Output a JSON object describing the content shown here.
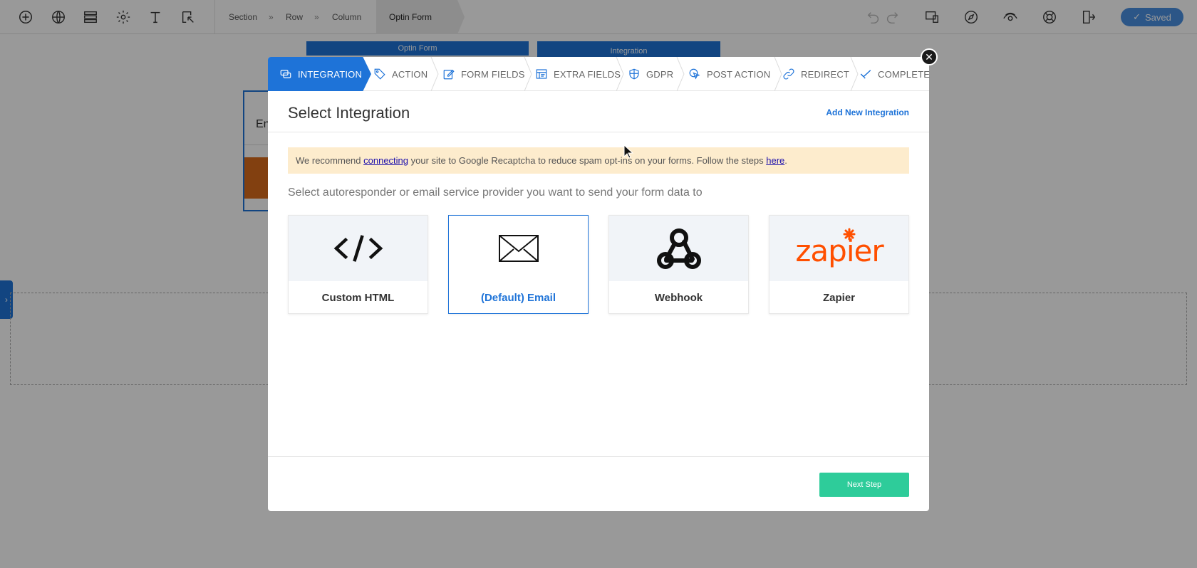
{
  "breadcrumb": {
    "section": "Section",
    "row": "Row",
    "column": "Column",
    "active": "Optin Form",
    "sep": "»"
  },
  "toolbar": {
    "saved_label": "Saved"
  },
  "canvas": {
    "optin_bar_label": "Optin Form",
    "integration_bar_label": "Integration",
    "input_ghost": "En"
  },
  "modal": {
    "steps": [
      {
        "label": "INTEGRATION",
        "icon": "integration-icon",
        "active": true
      },
      {
        "label": "ACTION",
        "icon": "tag-icon"
      },
      {
        "label": "FORM FIELDS",
        "icon": "edit-icon"
      },
      {
        "label": "EXTRA FIELDS",
        "icon": "extra-fields-icon"
      },
      {
        "label": "GDPR",
        "icon": "shield-icon"
      },
      {
        "label": "POST ACTION",
        "icon": "pointer-icon"
      },
      {
        "label": "REDIRECT",
        "icon": "link-icon"
      },
      {
        "label": "COMPLETE",
        "icon": "checkmark-icon"
      }
    ],
    "title": "Select Integration",
    "add_new_label": "Add New Integration",
    "notice": {
      "pre": "We recommend ",
      "link1": "connecting",
      "mid": " your site to Google Recaptcha to reduce spam opt-ins on your forms. Follow the steps ",
      "link2": "here",
      "post": "."
    },
    "instruction": "Select autoresponder or email service provider you want to send your form data to",
    "cards": [
      {
        "label": "Custom HTML",
        "icon": "code-icon"
      },
      {
        "label": "(Default) Email",
        "icon": "envelope-icon",
        "selected": true
      },
      {
        "label": "Webhook",
        "icon": "webhook-icon"
      },
      {
        "label": "Zapier",
        "icon": "zapier-logo"
      }
    ],
    "next_label": "Next Step"
  },
  "colors": {
    "primary": "#1e73d8",
    "success": "#2ecc9a",
    "notice_bg": "#fdeccd",
    "zapier": "#ff4f00"
  }
}
